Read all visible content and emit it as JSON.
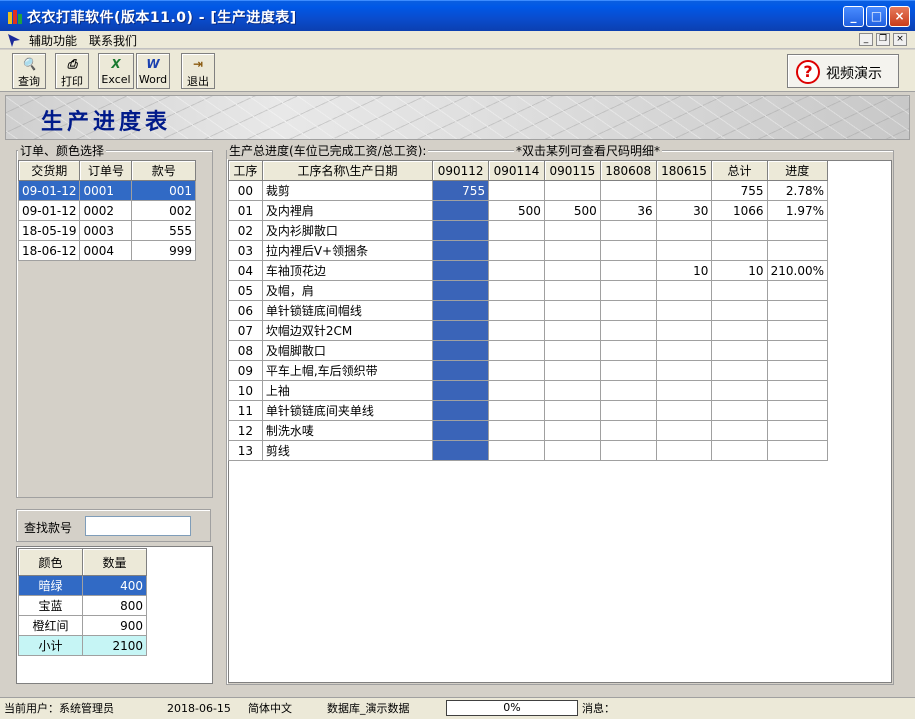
{
  "window": {
    "title": "衣衣打菲软件(版本11.0) - [生产进度表]",
    "min_label": "_",
    "max_label": "□",
    "close_label": "×"
  },
  "menu": {
    "items": [
      "辅助功能",
      "联系我们"
    ]
  },
  "toolbar": {
    "query": "查询",
    "print": "打印",
    "excel": "Excel",
    "word": "Word",
    "exit": "退出",
    "video": "视频演示"
  },
  "banner": {
    "title": "生产进度表"
  },
  "orders": {
    "group_label": "订单、颜色选择",
    "headers": [
      "交货期",
      "订单号",
      "款号"
    ],
    "rows": [
      [
        "09-01-12",
        "0001",
        "001"
      ],
      [
        "09-01-12",
        "0002",
        "002"
      ],
      [
        "18-05-19",
        "0003",
        "555"
      ],
      [
        "18-06-12",
        "0004",
        "999"
      ]
    ]
  },
  "search": {
    "label": "查找款号",
    "value": ""
  },
  "colors": {
    "headers": [
      "颜色",
      "数量"
    ],
    "rows": [
      [
        "暗绿",
        "400"
      ],
      [
        "宝蓝",
        "800"
      ],
      [
        "橙红间",
        "900"
      ],
      [
        "小计",
        "2100"
      ]
    ]
  },
  "progress": {
    "group_label": "生产总进度(车位已完成工资/总工资):",
    "hint": "*双击某列可查看尺码明细*",
    "headers": [
      "工序",
      "工序名称\\生产日期",
      "090112",
      "090114",
      "090115",
      "180608",
      "180615",
      "总计",
      "进度"
    ],
    "rows": [
      [
        "00",
        "裁剪",
        "755",
        "",
        "",
        "",
        "",
        "755",
        "2.78%"
      ],
      [
        "01",
        "及内裡肩",
        "",
        "500",
        "500",
        "36",
        "30",
        "1066",
        "1.97%"
      ],
      [
        "02",
        "及内衫脚散口",
        "",
        "",
        "",
        "",
        "",
        "",
        ""
      ],
      [
        "03",
        "拉内裡后V+领捆条",
        "",
        "",
        "",
        "",
        "",
        "",
        ""
      ],
      [
        "04",
        "车袖顶花边",
        "",
        "",
        "",
        "",
        "10",
        "10",
        "210.00%"
      ],
      [
        "05",
        "及帽，肩",
        "",
        "",
        "",
        "",
        "",
        "",
        ""
      ],
      [
        "06",
        "单针锁链底间帽线",
        "",
        "",
        "",
        "",
        "",
        "",
        ""
      ],
      [
        "07",
        "坎帽边双针2CM",
        "",
        "",
        "",
        "",
        "",
        "",
        ""
      ],
      [
        "08",
        "及帽脚散口",
        "",
        "",
        "",
        "",
        "",
        "",
        ""
      ],
      [
        "09",
        "平车上帽,车后领织带",
        "",
        "",
        "",
        "",
        "",
        "",
        ""
      ],
      [
        "10",
        "上袖",
        "",
        "",
        "",
        "",
        "",
        "",
        ""
      ],
      [
        "11",
        "单针锁链底间夹单线",
        "",
        "",
        "",
        "",
        "",
        "",
        ""
      ],
      [
        "12",
        "制洗水唛",
        "",
        "",
        "",
        "",
        "",
        "",
        ""
      ],
      [
        "13",
        "剪线",
        "",
        "",
        "",
        "",
        "",
        "",
        ""
      ]
    ]
  },
  "status": {
    "user": "当前用户：系统管理员",
    "date": "2018-06-15",
    "lang": "简体中文",
    "db": "数据库_演示数据",
    "progress_text": "0%",
    "progress_value": 0,
    "message": "消息："
  }
}
